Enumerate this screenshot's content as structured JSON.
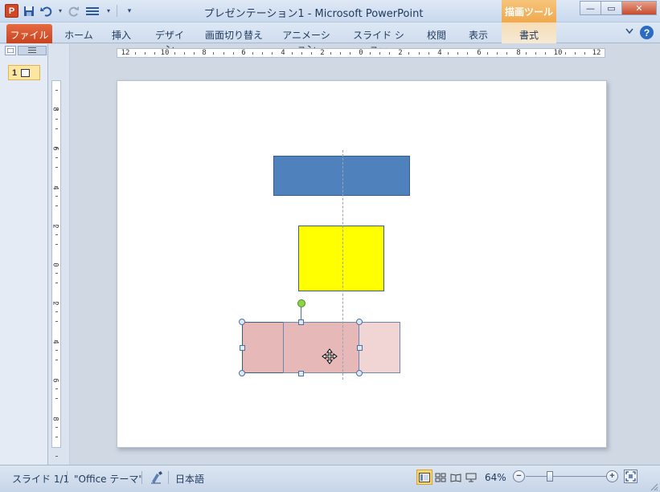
{
  "window": {
    "title": "プレゼンテーション1 - Microsoft PowerPoint",
    "context_tool": "描画ツール",
    "logo_letter": "P",
    "min_glyph": "—",
    "max_glyph": "▭",
    "close_glyph": "✕"
  },
  "ribbon": {
    "tabs": [
      "ファイル",
      "ホーム",
      "挿入",
      "デザイン",
      "画面切り替え",
      "アニメーション",
      "スライド ショー",
      "校閲",
      "表示",
      "書式"
    ],
    "help_glyph": "?",
    "minimize_glyph": "♡"
  },
  "thumbnails": {
    "slide_number": "1"
  },
  "rulers": {
    "horizontal": [
      "12",
      "10",
      "8",
      "6",
      "4",
      "2",
      "0",
      "2",
      "4",
      "6",
      "8",
      "10",
      "12"
    ],
    "vertical": [
      "8",
      "6",
      "4",
      "2",
      "0",
      "2",
      "4",
      "6",
      "8"
    ]
  },
  "statusbar": {
    "slide_info": "スライド 1/1",
    "theme": "\"Office テーマ\"",
    "language": "日本語",
    "zoom": "64%",
    "zoom_minus": "−",
    "zoom_plus": "+"
  },
  "colors": {
    "shape_blue": "#4f81bd",
    "shape_yellow": "#ffff00",
    "shape_pink": "#e6b9b8",
    "file_tab": "#d24726",
    "context_tab": "#f0a94e"
  }
}
